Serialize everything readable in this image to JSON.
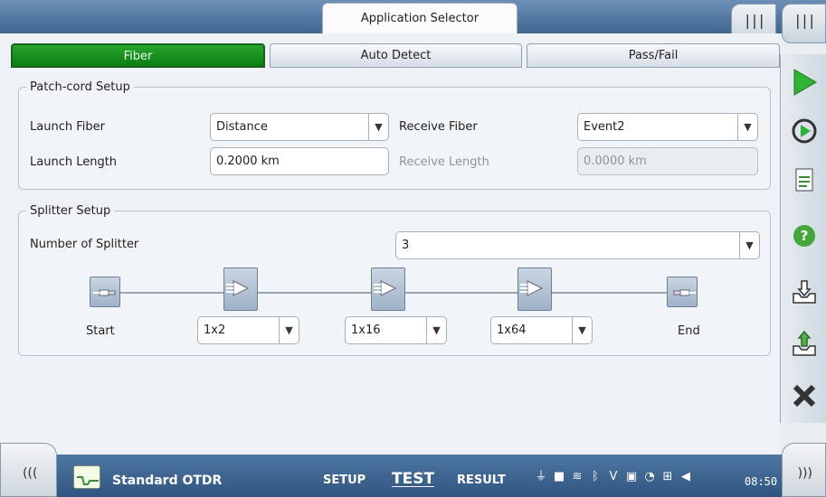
{
  "header": {
    "app_selector": "Application Selector"
  },
  "tabs": [
    {
      "label": "Fiber",
      "active": true
    },
    {
      "label": "Auto Detect",
      "active": false
    },
    {
      "label": "Pass/Fail",
      "active": false
    }
  ],
  "patch_cord": {
    "legend": "Patch-cord Setup",
    "launch_fiber_label": "Launch Fiber",
    "launch_fiber_value": "Distance",
    "receive_fiber_label": "Receive Fiber",
    "receive_fiber_value": "Event2",
    "launch_length_label": "Launch Length",
    "launch_length_value": "0.2000 km",
    "receive_length_label": "Receive Length",
    "receive_length_value": "0.0000 km"
  },
  "splitter": {
    "legend": "Splitter Setup",
    "count_label": "Number of Splitter",
    "count_value": "3",
    "start_label": "Start",
    "end_label": "End",
    "ratios": [
      "1x2",
      "1x16",
      "1x64"
    ]
  },
  "bottom_bar": {
    "app_name": "Standard OTDR",
    "nav_setup": "SETUP",
    "nav_test": "TEST",
    "nav_result": "RESULT",
    "clock": "08:50"
  },
  "colors": {
    "active_tab": "#1a8f20",
    "bar": "#3f6790"
  }
}
